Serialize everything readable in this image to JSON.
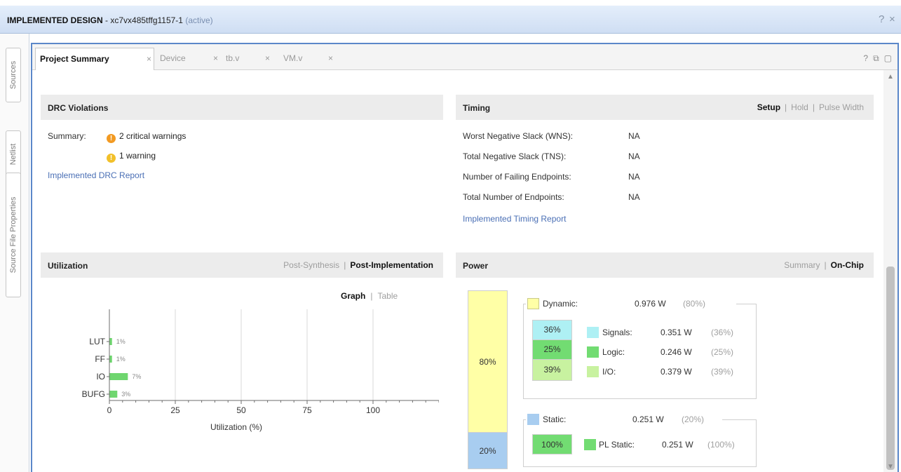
{
  "window": {
    "title_bold": "IMPLEMENTED DESIGN",
    "title_part": " - xc7vx485tffg1157-1 ",
    "title_state": "(active)",
    "help_icon": "question-icon",
    "close_icon": "close-icon"
  },
  "side_tabs": [
    "Sources",
    "Netlist",
    "Source File Properties"
  ],
  "tabs": [
    {
      "label": "Project Summary",
      "selected": true
    },
    {
      "label": "Device",
      "selected": false
    },
    {
      "label": "tb.v",
      "selected": false
    },
    {
      "label": "VM.v",
      "selected": false
    }
  ],
  "tab_close_glyph": "×",
  "drc": {
    "title": "DRC Violations",
    "summary_label": "Summary:",
    "critical": "2 critical warnings",
    "warning": "1 warning",
    "report_link": "Implemented DRC Report"
  },
  "timing": {
    "title": "Timing",
    "options": [
      "Setup",
      "Hold",
      "Pulse Width"
    ],
    "active_option": "Setup",
    "rows": [
      {
        "label": "Worst Negative Slack (WNS):",
        "value": "NA"
      },
      {
        "label": "Total Negative Slack (TNS):",
        "value": "NA"
      },
      {
        "label": "Number of Failing Endpoints:",
        "value": "NA"
      },
      {
        "label": "Total Number of Endpoints:",
        "value": "NA"
      }
    ],
    "report_link": "Implemented Timing Report"
  },
  "utilization": {
    "title": "Utilization",
    "options": [
      "Post-Synthesis",
      "Post-Implementation"
    ],
    "active_option": "Post-Implementation",
    "view_options": [
      "Graph",
      "Table"
    ],
    "active_view": "Graph"
  },
  "chart_data": {
    "type": "bar",
    "orientation": "horizontal",
    "categories": [
      "LUT",
      "FF",
      "IO",
      "BUFG"
    ],
    "values": [
      1,
      1,
      7,
      3
    ],
    "value_labels": [
      "1%",
      "1%",
      "7%",
      "3%"
    ],
    "xlabel": "Utilization (%)",
    "ylabel": "",
    "xlim": [
      0,
      125
    ],
    "xticks": [
      "0",
      "25",
      "50",
      "75",
      "100"
    ],
    "grid": true,
    "bar_color": "#6fd66f"
  },
  "power": {
    "title": "Power",
    "options": [
      "Summary",
      "On-Chip"
    ],
    "active_option": "On-Chip",
    "bar": [
      {
        "label": "80%",
        "fraction": 0.8,
        "color": "#ffffa6"
      },
      {
        "label": "20%",
        "fraction": 0.2,
        "color": "#a8cdf0"
      }
    ],
    "dynamic": {
      "label": "Dynamic:",
      "value": "0.976 W",
      "pct": "(80%)",
      "color": "#ffffa6"
    },
    "dynamic_rows": [
      {
        "cell": "36%",
        "label": "Signals:",
        "value": "0.351 W",
        "pct": "(36%)",
        "color": "#aef0f4"
      },
      {
        "cell": "25%",
        "label": "Logic:",
        "value": "0.246 W",
        "pct": "(25%)",
        "color": "#72dc72"
      },
      {
        "cell": "39%",
        "label": "I/O:",
        "value": "0.379 W",
        "pct": "(39%)",
        "color": "#c8f2a0"
      }
    ],
    "static": {
      "label": "Static:",
      "value": "0.251 W",
      "pct": "(20%)",
      "color": "#a8cdf0"
    },
    "static_rows": [
      {
        "cell": "100%",
        "label": "PL Static:",
        "value": "0.251 W",
        "pct": "(100%)",
        "color": "#72dc72"
      }
    ]
  }
}
